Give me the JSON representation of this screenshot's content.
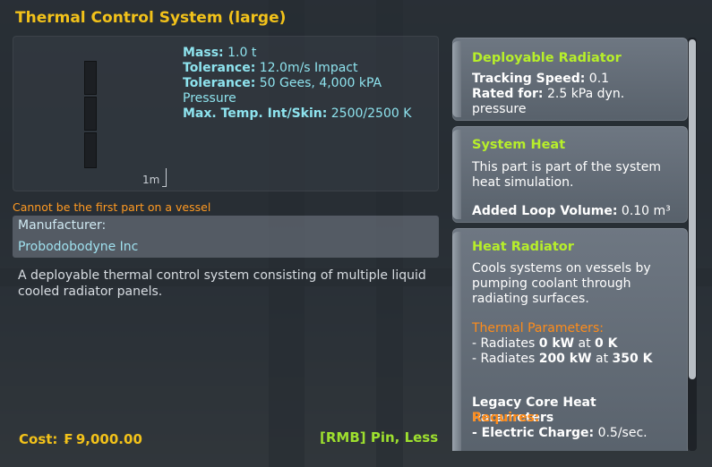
{
  "window": {
    "title": "Thermal Control System (large)"
  },
  "preview": {
    "scale_label": "1m"
  },
  "stats": [
    {
      "label": "Mass:",
      "value": " 1.0 t"
    },
    {
      "label": "Tolerance:",
      "value": " 12.0m/s Impact"
    },
    {
      "label": "Tolerance:",
      "value": " 50 Gees, 4,000 kPA Pressure"
    },
    {
      "label": "Max. Temp. Int/Skin:",
      "value": " 2500/2500 K"
    }
  ],
  "warning": "Cannot be the first part on a vessel",
  "manufacturer": {
    "label": "Manufacturer:",
    "name": "Probodobodyne Inc"
  },
  "description": "A deployable thermal control system consisting of multiple liquid cooled radiator panels.",
  "footer": {
    "cost_label": "Cost:",
    "fund_icon": "funds-icon",
    "cost_value": "9,000.00",
    "hint": "[RMB] Pin, Less"
  },
  "modules": {
    "deployable": {
      "title": "Deployable Radiator",
      "tracking_label": "Tracking Speed:",
      "tracking_value": " 0.1",
      "rated_label": "Rated for:",
      "rated_value": " 2.5 kPa dyn. pressure"
    },
    "system_heat": {
      "title": "System Heat",
      "text": "This part is part of the system heat simulation.",
      "loop_label": "Added Loop Volume:",
      "loop_value": " 0.10 m³"
    },
    "heat_radiator": {
      "title": "Heat Radiator",
      "text": "Cools systems on vessels by pumping coolant through radiating surfaces.",
      "params_title": "Thermal Parameters:",
      "line1_pre": " - Radiates ",
      "line1_b1": "0 kW",
      "line1_mid": " at ",
      "line1_b2": "0 K",
      "line2_pre": " - Radiates ",
      "line2_b1": "200 kW",
      "line2_mid": " at ",
      "line2_b2": "350 K",
      "legacy_title": "Legacy Core Heat Parameters",
      "requires": "Requires:",
      "resource_label": "- Electric Charge:",
      "resource_value": " 0.5/sec."
    }
  },
  "colors": {
    "title": "#f2c21a",
    "module_title": "#b7ef2a",
    "warning": "#ff9a22",
    "stats": "#8ee3ee"
  }
}
